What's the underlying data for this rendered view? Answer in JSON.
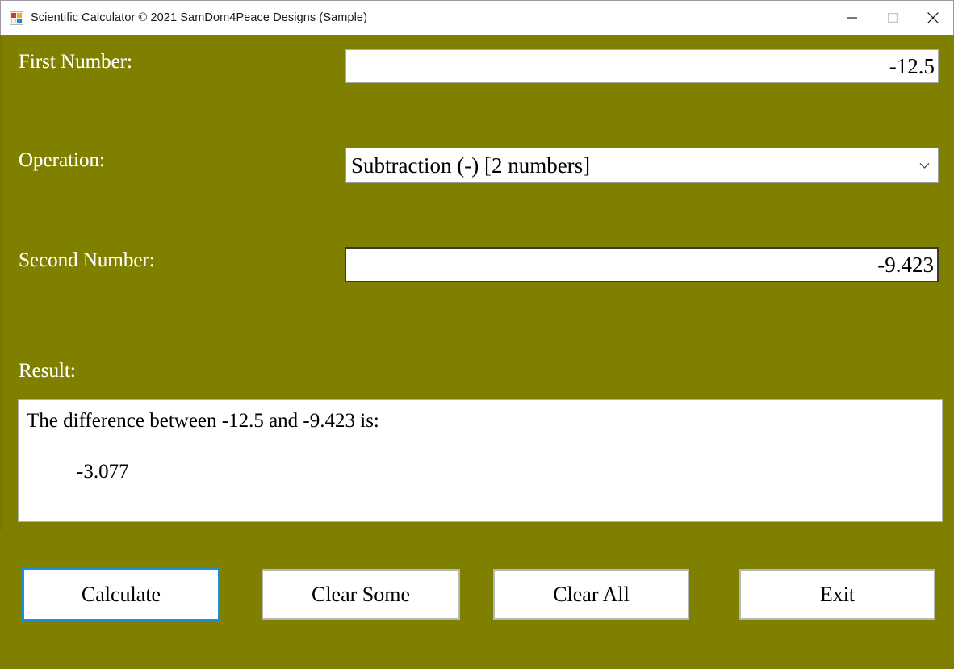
{
  "window": {
    "title": "Scientific Calculator © 2021 SamDom4Peace Designs (Sample)",
    "app_icon": "windows-forms-app-icon",
    "background_color": "#808000",
    "controls": {
      "minimize": "minimize-icon",
      "maximize": "maximize-icon",
      "close": "close-icon"
    }
  },
  "form": {
    "first_number": {
      "label": "First Number:",
      "value": "-12.5",
      "placeholder": ""
    },
    "operation": {
      "label": "Operation:",
      "selected": "Subtraction (-) [2 numbers]",
      "arrow_icon": "chevron-down-icon",
      "options": [
        "Subtraction (-) [2 numbers]"
      ]
    },
    "second_number": {
      "label": "Second Number:",
      "value": "-9.423",
      "placeholder": ""
    },
    "result": {
      "label": "Result:",
      "line_1": "The difference between -12.5 and -9.423 is:",
      "line_2": "-3.077"
    }
  },
  "buttons": {
    "calculate": {
      "label": "Calculate",
      "focused": true,
      "focus_color": "#1a8fe0"
    },
    "clear_some": {
      "label": "Clear Some",
      "focused": false
    },
    "clear_all": {
      "label": "Clear All",
      "focused": false
    },
    "exit": {
      "label": "Exit",
      "focused": false
    }
  }
}
